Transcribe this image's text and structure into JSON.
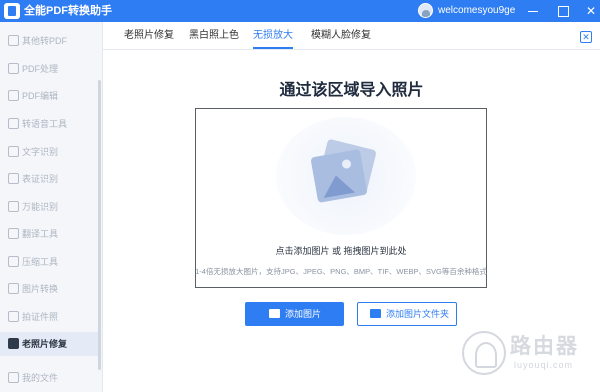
{
  "window": {
    "title": "全能PDF转换助手",
    "username": "welcomesyou9ge"
  },
  "sidebar": {
    "items": [
      {
        "label": "其他转PDF",
        "active": false
      },
      {
        "label": "PDF处理",
        "active": false
      },
      {
        "label": "PDF编辑",
        "active": false
      },
      {
        "label": "转语音工具",
        "active": false
      },
      {
        "label": "文字识别",
        "active": false
      },
      {
        "label": "表证识别",
        "active": false
      },
      {
        "label": "万能识别",
        "active": false
      },
      {
        "label": "翻译工具",
        "active": false
      },
      {
        "label": "压缩工具",
        "active": false
      },
      {
        "label": "图片转换",
        "active": false
      },
      {
        "label": "拍证件照",
        "active": false
      },
      {
        "label": "老照片修复",
        "active": true
      },
      {
        "label": "我的文件",
        "active": false
      }
    ]
  },
  "tabs": [
    {
      "label": "老照片修复",
      "active": false
    },
    {
      "label": "黑白照上色",
      "active": false
    },
    {
      "label": "无损放大",
      "active": true
    },
    {
      "label": "模糊人脸修复",
      "active": false
    }
  ],
  "main": {
    "heading": "通过该区域导入照片",
    "hint": "点击添加图片 或 拖拽图片到此处",
    "formats": "1-4倍无损放大图片，支持JPG、JPEG、PNG、BMP、TIF、WEBP、SVG等百余种格式",
    "add_image_label": "添加图片",
    "add_folder_label": "添加图片文件夹"
  },
  "watermark": {
    "text": "路由器",
    "sub": "luyouqi.com"
  },
  "colors": {
    "accent": "#2f7df2",
    "sidebar_bg": "#f4f6fa"
  }
}
